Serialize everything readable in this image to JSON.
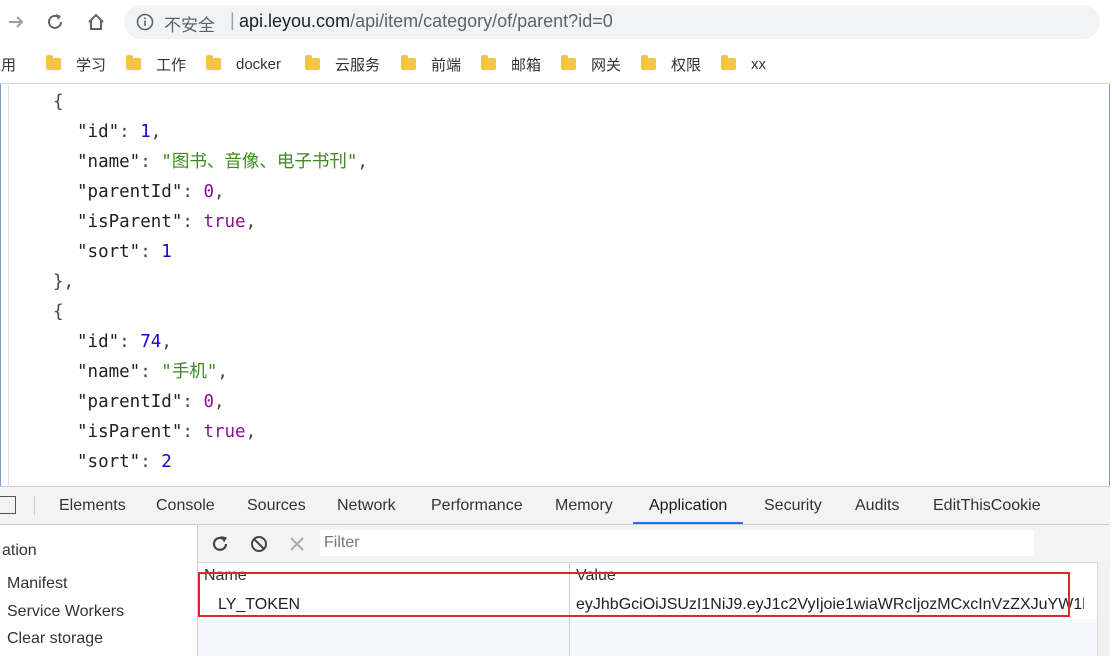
{
  "browser": {
    "insecure_label": "不安全",
    "separator": "|",
    "url_host": "api.leyou.com",
    "url_path": "/api/item/category/of/parent?id=0"
  },
  "bookmarks": {
    "apps_partial": "应用",
    "items": [
      "学习",
      "工作",
      "docker",
      "云服务",
      "前端",
      "邮箱",
      "网关",
      "权限",
      "xx"
    ]
  },
  "json_lines": [
    "{",
    "\"id\": 1,",
    "\"name\": \"图书、音像、电子书刊\",",
    "\"parentId\": 0,",
    "\"isParent\": true,",
    "\"sort\": 1",
    "},",
    "{",
    "\"id\": 74,",
    "\"name\": \"手机\",",
    "\"parentId\": 0,",
    "\"isParent\": true,",
    "\"sort\": 2"
  ],
  "devtools": {
    "tabs": [
      "Elements",
      "Console",
      "Sources",
      "Network",
      "Performance",
      "Memory",
      "Application",
      "Security",
      "Audits",
      "EditThisCookie"
    ],
    "active_tab": "Application",
    "sidebar": {
      "section_partial": "ation",
      "items": [
        "Manifest",
        "Service Workers",
        "Clear storage"
      ]
    },
    "filter_placeholder": "Filter",
    "table": {
      "columns": [
        "Name",
        "Value"
      ],
      "rows": [
        {
          "name": "LY_TOKEN",
          "value": "eyJhbGciOiJSUzI1NiJ9.eyJ1c2VyIjoie1wiaWRcIjozMCxcInVzZXJuYW1l..."
        }
      ]
    },
    "highlight_color": "#e0262d",
    "accent_color": "#1a73e8"
  }
}
